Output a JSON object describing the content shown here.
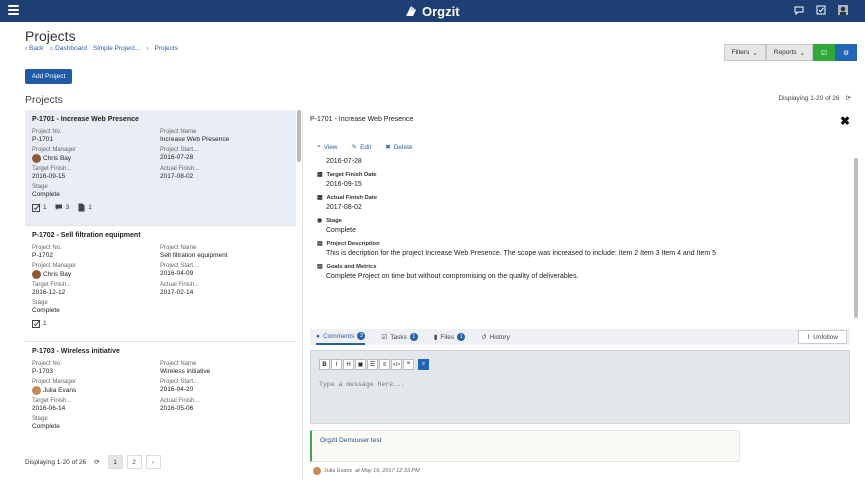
{
  "app": {
    "brand": "Orgzit"
  },
  "page": {
    "title": "Projects",
    "section_title": "Projects",
    "add_button": "Add Project",
    "displaying": "Displaying 1-20 of 26"
  },
  "breadcrumb": {
    "back": "Back",
    "dashboard": "Dashboard",
    "simple_project": "Simple Project...",
    "projects": "Projects"
  },
  "toolbar": {
    "filters": "Filters",
    "reports": "Reports"
  },
  "labels": {
    "project_no": "Project No.",
    "project_name": "Project Name",
    "project_manager": "Project Manager",
    "project_start": "Project Start...",
    "target_finish": "Target Finish...",
    "actual_finish": "Actual Finish...",
    "stage": "Stage"
  },
  "projects": [
    {
      "title": "P-1701 - Increase Web Presence",
      "no": "P-1701",
      "name": "Increase Web Presence",
      "manager": "Chris Bay",
      "start": "2016-07-28",
      "target": "2016-09-15",
      "actual": "2017-08-02",
      "stage": "Complete",
      "tasks": "1",
      "comments": "3",
      "files": "1"
    },
    {
      "title": "P-1702 - Sell filtration equipment",
      "no": "P-1702",
      "name": "Sell filtration equipment",
      "manager": "Chris Bay",
      "start": "2016-04-09",
      "target": "2016-12-12",
      "actual": "2017-02-14",
      "stage": "Complete",
      "tasks": "1"
    },
    {
      "title": "P-1703 - Wireless initiative",
      "no": "P-1703",
      "name": "Wireless initiative",
      "manager": "Julia Evans",
      "start": "2016-04-20",
      "target": "2016-06-14",
      "actual": "2016-05-06",
      "stage": "Complete"
    }
  ],
  "pager": {
    "text": "Displaying 1-20 of 26",
    "page1": "1",
    "page2": "2",
    "next": "›"
  },
  "detail": {
    "title": "P-1701 - Increase Web Presence",
    "close": "✖",
    "view": "View",
    "edit": "Edit",
    "delete": "Delete",
    "top_value": "2016-07-28",
    "target_finish_label": "Target Finish Date",
    "target_finish": "2016-09-15",
    "actual_finish_label": "Actual Finish Date",
    "actual_finish": "2017-08-02",
    "stage_label": "Stage",
    "stage": "Complete",
    "desc_label": "Project Description",
    "desc": "This is decription for the project Increase Web Presence. The scope was increased to include: Item 2 Item 3 Item 4 and Item 5",
    "goals_label": "Goals and Metrics",
    "goals": "Complete Project on time but without compromising on the quality of deliverables."
  },
  "tabs": {
    "comments": "Comments",
    "comments_count": "3",
    "tasks": "Tasks",
    "tasks_count": "1",
    "files": "Files",
    "files_count": "1",
    "history": "History",
    "unfollow": "Unfollow"
  },
  "editor": {
    "bold": "B",
    "italic": "I",
    "heading": "H",
    "image": "▣",
    "ul": "☰",
    "ol": "≡",
    "code": "</>",
    "quote": "❝",
    "placeholder": "Type a message here..."
  },
  "comment": {
    "text": "Orgzit Demouser test",
    "author": "Julia Evans",
    "at": "at May 16, 2017 12:33 PM"
  },
  "colors": {
    "topbar": "#1e3f74",
    "primary": "#1e5aa5",
    "green": "#31a83a",
    "link": "#2a5ea8"
  }
}
